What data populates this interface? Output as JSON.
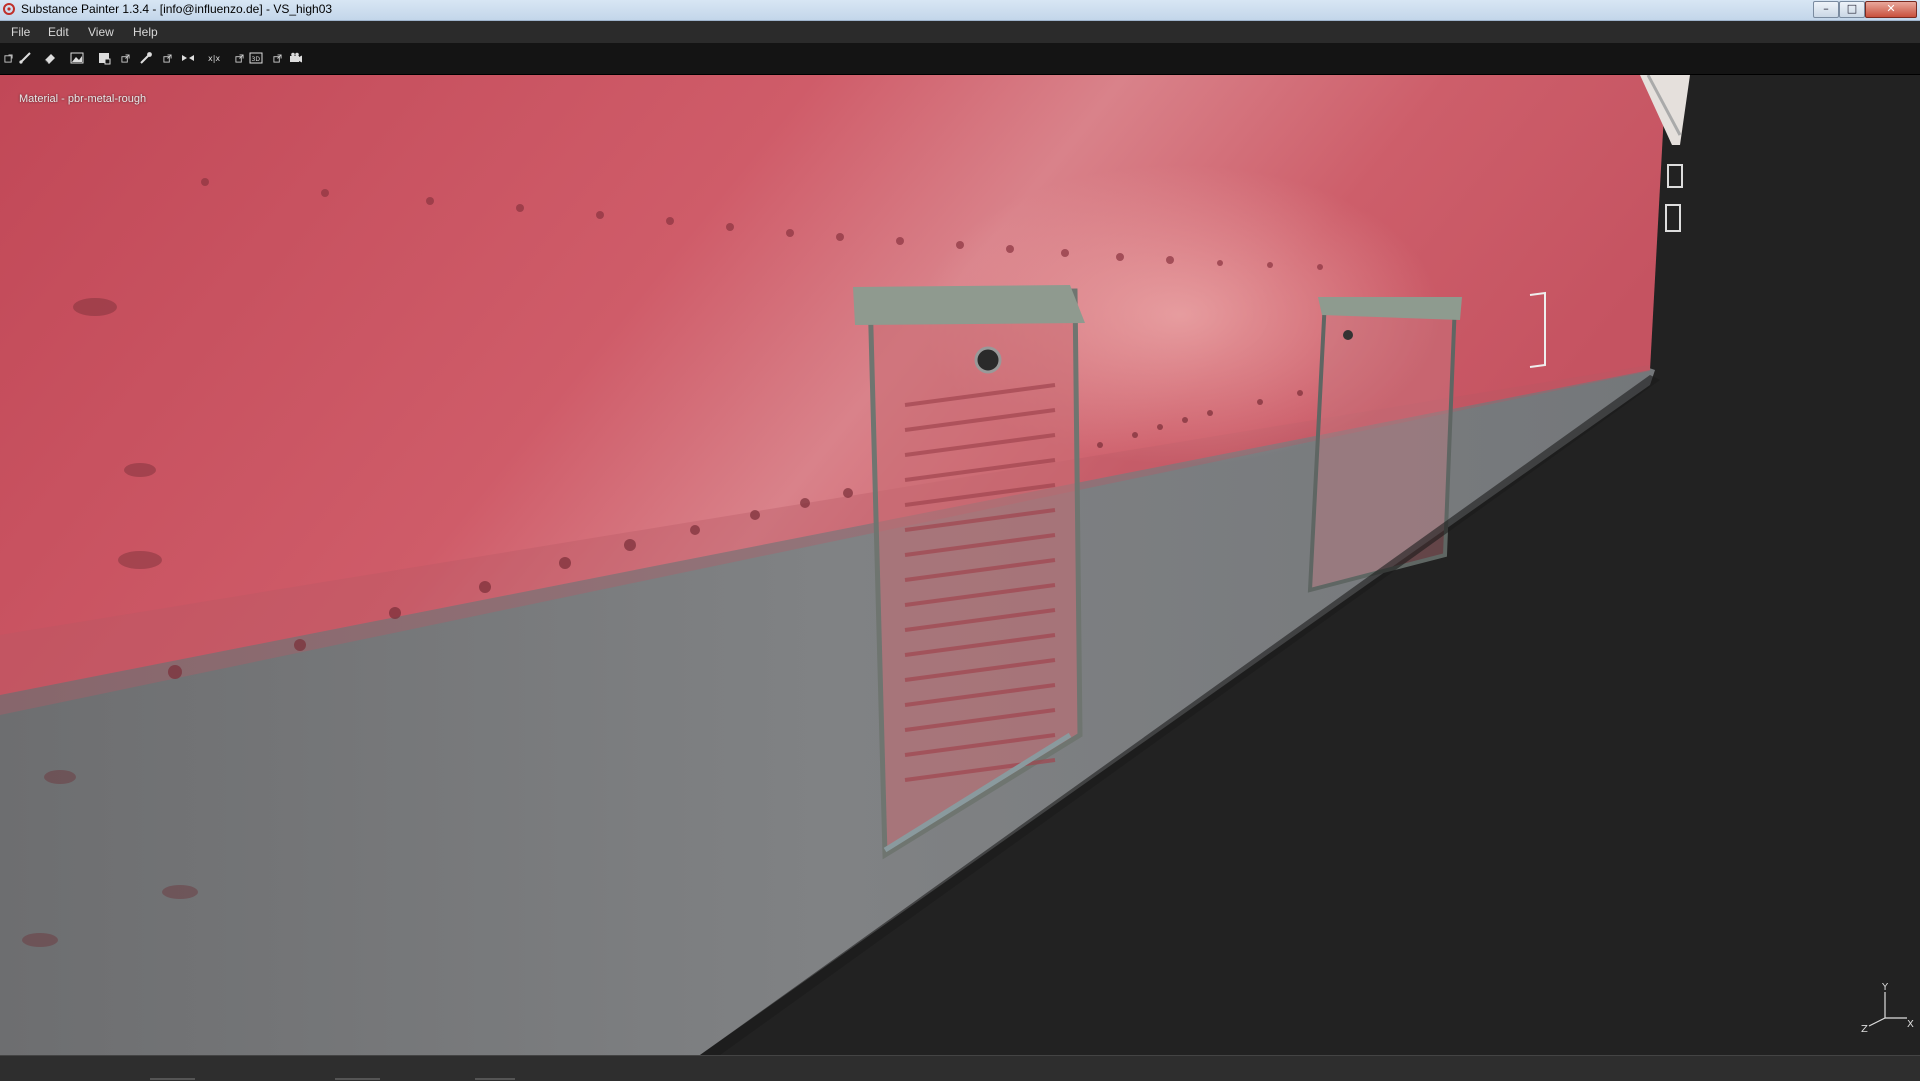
{
  "window": {
    "title": "Substance Painter 1.3.4 - [info@influenzo.de] - VS_high03",
    "minimize_label": "–",
    "maximize_label": "□",
    "close_label": "✕"
  },
  "menu": {
    "items": [
      {
        "label": "File"
      },
      {
        "label": "Edit"
      },
      {
        "label": "View"
      },
      {
        "label": "Help"
      }
    ]
  },
  "toolbar": {
    "tools": [
      {
        "icon": "new-layer-icon"
      },
      {
        "icon": "brush-icon"
      },
      {
        "icon": "eraser-icon"
      },
      {
        "icon": "projection-icon"
      },
      {
        "icon": "polygon-fill-icon"
      },
      {
        "icon": "popout-icon"
      },
      {
        "icon": "color-picker-icon"
      },
      {
        "icon": "popout-icon"
      },
      {
        "icon": "symmetry-icon"
      },
      {
        "icon": "mirror-x-icon"
      },
      {
        "icon": "popout-icon"
      },
      {
        "icon": "view-3d-icon"
      },
      {
        "icon": "popout-icon"
      },
      {
        "icon": "camera-icon"
      }
    ]
  },
  "viewport": {
    "label": "Material - pbr-metal-rough",
    "axis": {
      "y": "Y",
      "z": "Z",
      "x": "X"
    },
    "colors": {
      "red_paint": "#c9515f",
      "grey_metal": "#7e7f80",
      "background": "#222222"
    }
  }
}
